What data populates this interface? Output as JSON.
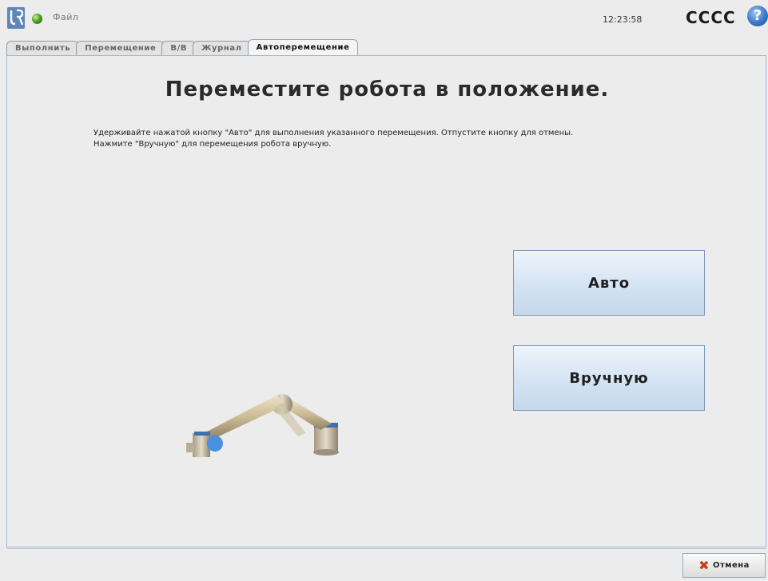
{
  "header": {
    "file_menu": "Файл",
    "clock": "12:23:58",
    "robot_name": "CCCC",
    "help": "?"
  },
  "tabs": [
    {
      "label": "Выполнить",
      "active": false
    },
    {
      "label": "Перемещение",
      "active": false
    },
    {
      "label": "В/В",
      "active": false
    },
    {
      "label": "Журнал",
      "active": false
    },
    {
      "label": "Автоперемещение",
      "active": true
    }
  ],
  "main": {
    "title": "Переместите робота в положение.",
    "instruction_line1": "Удерживайте нажатой кнопку \"Авто\" для выполнения указанного перемещения. Отпустите кнопку для отмены.",
    "instruction_line2": "Нажмите \"Вручную\" для перемещения робота вручную.",
    "auto_button": "Авто",
    "manual_button": "Вручную"
  },
  "footer": {
    "cancel_label": "Отмена"
  },
  "colors": {
    "accent_blue": "#4a8fe0",
    "button_border": "#7e97b8",
    "cancel_x": "#c93a12"
  },
  "icons": {
    "logo": "ur-logo-icon",
    "status": "status-dot-icon",
    "help": "help-icon",
    "cancel": "cancel-x-icon"
  }
}
